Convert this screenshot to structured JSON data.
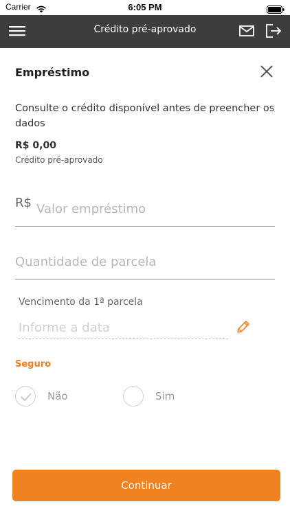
{
  "status_bar": {
    "carrier": "Carrier",
    "time": "6:05 PM",
    "wifi_icon": "wifi-icon",
    "battery_icon": "battery-icon"
  },
  "nav_bar": {
    "title": "Crédito pré-aprovado",
    "menu_icon": "hamburger-menu-icon",
    "mail_icon": "mail-icon",
    "logout_icon": "logout-icon",
    "background": "#3d3d3d"
  },
  "modal": {
    "title": "Empréstimo",
    "close_icon": "close-icon",
    "description": "Consulte o crédito disponível antes de preencher os dados",
    "balance_value": "R$ 0,00",
    "balance_label": "Crédito pré-aprovado"
  },
  "form": {
    "currency_prefix": "R$",
    "amount_placeholder": "Valor empréstimo",
    "amount_value": "",
    "installments_placeholder": "Quantidade de parcela",
    "installments_value": "",
    "due_date_label": "Vencimento da 1ª parcela",
    "due_date_placeholder": "Informe a data",
    "due_date_value": "",
    "edit_icon": "pencil-icon",
    "insurance_label": "Seguro",
    "insurance_options": [
      {
        "label": "Não",
        "icon": "checkmark-icon"
      },
      {
        "label": "Sim",
        "icon": ""
      }
    ],
    "continue_label": "Continuar"
  },
  "colors": {
    "accent": "#f0821f",
    "insurance_label": "#ef7d1e",
    "nav_background": "#3d3d3d"
  }
}
